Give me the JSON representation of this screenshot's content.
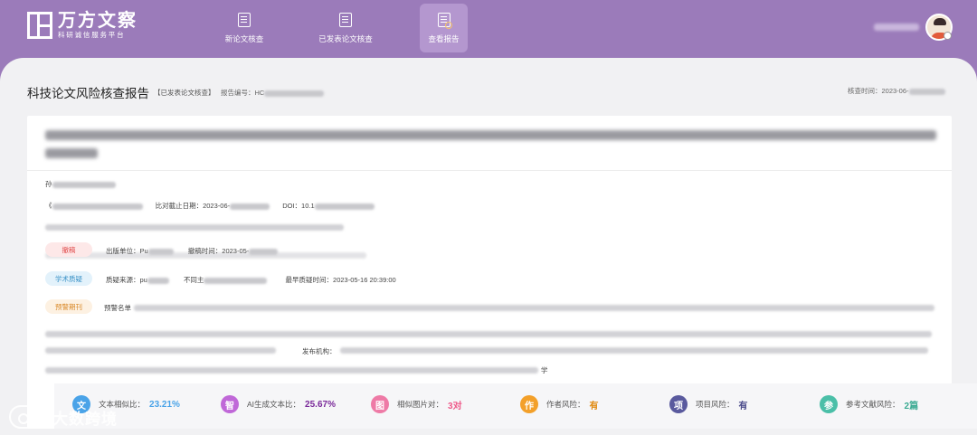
{
  "brand": {
    "name": "万方文察",
    "tagline": "科研诚信服务平台"
  },
  "nav": {
    "items": [
      {
        "label": "新论文核查",
        "icon": "document-icon"
      },
      {
        "label": "已发表论文核查",
        "icon": "document-list-icon"
      },
      {
        "label": "查看报告",
        "icon": "report-search-icon",
        "active": true
      }
    ]
  },
  "header": {
    "page_title": "科技论文风险核查报告",
    "type_tag": "【已发表论文核查】",
    "report_no_label": "报告编号：HC",
    "check_time_label": "核查时间：2023-06-"
  },
  "paper": {
    "author_prefix": "孙",
    "journal_open": "《",
    "deadline_label": "比对截止日期：2023-06-",
    "doi_label": "DOI：10.1",
    "retraction": {
      "tag": "撤稿",
      "publisher_label": "出版单位：Pu",
      "time_label": "撤稿时间：2023-05-"
    },
    "doubt": {
      "tag": "学术质疑",
      "source_label": "质疑来源：pu",
      "differ_label": "不同主",
      "earliest_label": "最早质疑时间：",
      "earliest_value": "2023-05-16 20:39:00"
    },
    "warning": {
      "tag": "预警期刊",
      "list_label": "预警名单",
      "org_label": "发布机构：",
      "tail": "学"
    }
  },
  "stats": [
    {
      "icon_char": "文",
      "label": "文本相似比：",
      "value": "23.21%",
      "color": "#4aa3e8"
    },
    {
      "icon_char": "智",
      "label": "AI生成文本比：",
      "value": "25.67%",
      "color": "#c068d8"
    },
    {
      "icon_char": "图",
      "label": "相似图片对：",
      "value": "3对",
      "color": "#ee7aa6"
    },
    {
      "icon_char": "作",
      "label": "作者风险：",
      "value": "有",
      "color": "#f3a02a"
    },
    {
      "icon_char": "项",
      "label": "项目风险：",
      "value": "有",
      "color": "#5a5a9e"
    },
    {
      "icon_char": "参",
      "label": "参考文献风险：",
      "value": "2篇",
      "color": "#4bbfa8"
    }
  ],
  "watermark": {
    "text": "大数跨境"
  }
}
